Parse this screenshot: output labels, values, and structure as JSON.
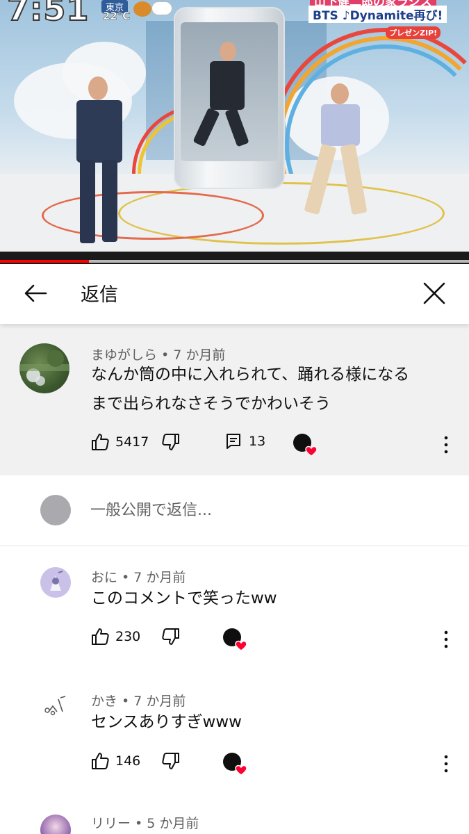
{
  "video": {
    "clock": "7:51",
    "city": "東京",
    "temperature": "22℃",
    "caption_top": "山下健二郎の家ラジス",
    "caption_bottom": "BTS ♪Dynamite再び!",
    "caption_tag": "プレゼンZIP!",
    "progress_fraction": 0.19
  },
  "header": {
    "title": "返信",
    "back_icon": "arrow-left-icon",
    "close_icon": "close-icon"
  },
  "parent_comment": {
    "author": "まゆがしら",
    "time": "7 か月前",
    "meta": "まゆがしら • 7 か月前",
    "text_line1": "なんか筒の中に入れられて、踊れる様になる",
    "text_line2": "まで出られなさそうでかわいそう",
    "likes": "5417",
    "replies": "13"
  },
  "reply_input": {
    "placeholder": "一般公開で返信..."
  },
  "replies": [
    {
      "meta": "おに • 7 か月前",
      "text": "このコメントで笑ったww",
      "likes": "230"
    },
    {
      "meta": "かき • 7 か月前",
      "text": "センスありすぎwww",
      "likes": "146"
    },
    {
      "meta": "リリー • 5 か月前"
    }
  ],
  "colors": {
    "accent_red": "#ff0000",
    "heart_red": "#ff0033",
    "parent_bg": "#f1f1f1",
    "meta_gray": "#606060"
  }
}
